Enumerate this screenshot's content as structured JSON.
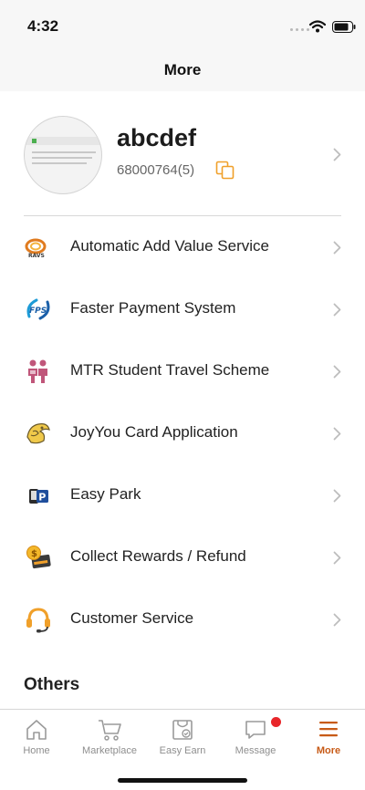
{
  "status_bar": {
    "time": "4:32"
  },
  "nav": {
    "title": "More"
  },
  "profile": {
    "name": "abcdef",
    "member_id": "68000764(5)"
  },
  "menu": [
    {
      "label": "Automatic Add Value Service",
      "icon": "aavs-icon"
    },
    {
      "label": "Faster Payment System",
      "icon": "fps-icon"
    },
    {
      "label": "MTR Student Travel Scheme",
      "icon": "student-travel-icon"
    },
    {
      "label": "JoyYou Card Application",
      "icon": "joyyou-card-icon"
    },
    {
      "label": "Easy Park",
      "icon": "easy-park-icon"
    },
    {
      "label": "Collect Rewards / Refund",
      "icon": "rewards-refund-icon"
    },
    {
      "label": "Customer Service",
      "icon": "headset-icon"
    }
  ],
  "others": {
    "title": "Others"
  },
  "tabs": [
    {
      "label": "Home",
      "icon": "home-icon"
    },
    {
      "label": "Marketplace",
      "icon": "cart-icon"
    },
    {
      "label": "Easy Earn",
      "icon": "bag-icon"
    },
    {
      "label": "Message",
      "icon": "chat-icon"
    },
    {
      "label": "More",
      "icon": "menu-icon",
      "active": true
    }
  ],
  "colors": {
    "accent": "#c75a16",
    "badge": "#e8262a",
    "copy_icon": "#f0a02a"
  }
}
